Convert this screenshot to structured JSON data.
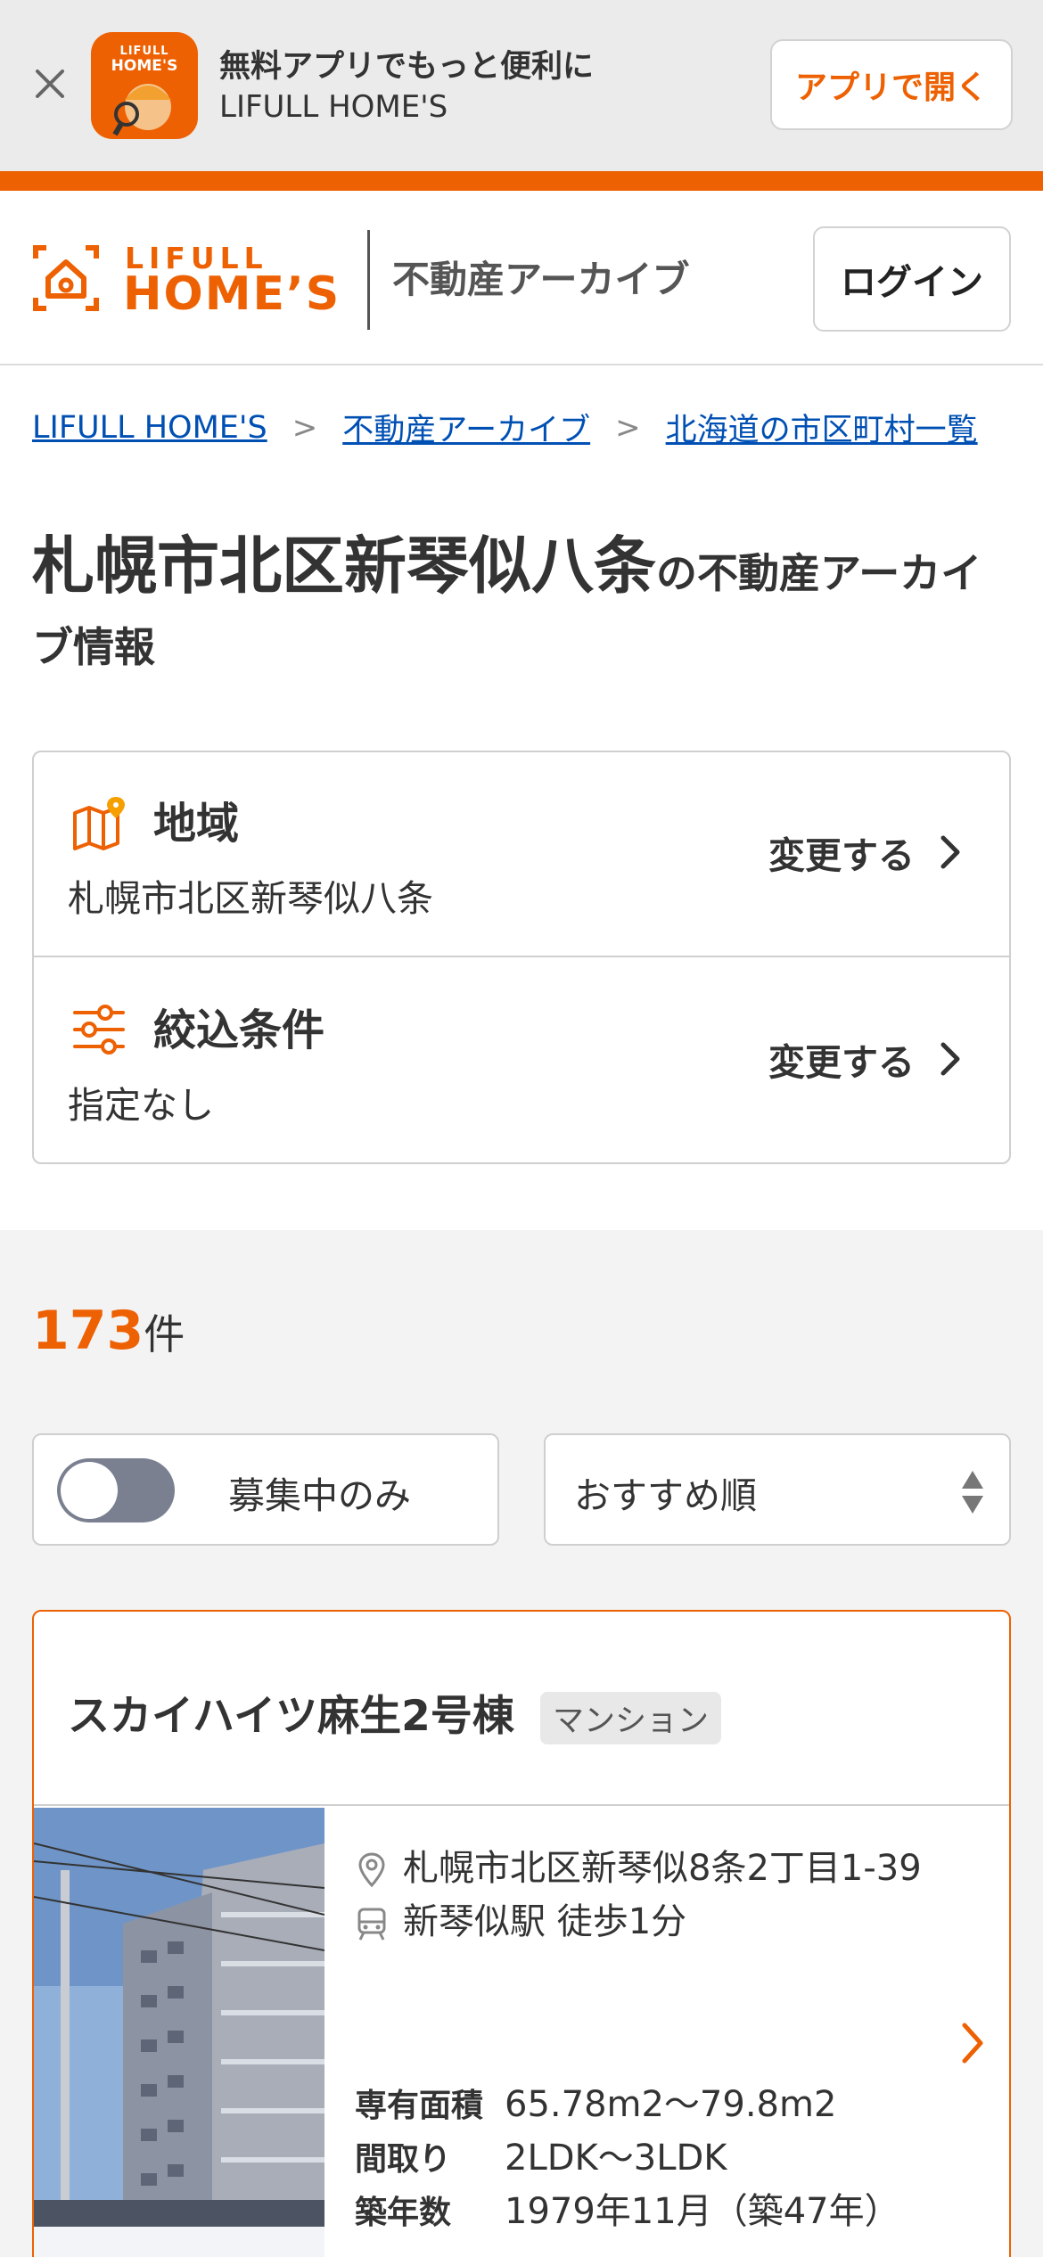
{
  "app_banner": {
    "title": "無料アプリでもっと便利に",
    "subtitle": "LIFULL HOME'S",
    "icon_small_text": "LIFULL",
    "icon_big_text": "HOME'S",
    "open_button": "アプリで開く"
  },
  "header": {
    "logo_line1": "LIFULL",
    "logo_line2": "HOME’S",
    "section": "不動産アーカイブ",
    "login_button": "ログイン"
  },
  "breadcrumb": [
    "LIFULL HOME'S",
    "不動産アーカイブ",
    "北海道の市区町村一覧"
  ],
  "breadcrumb_separator": ">",
  "page_title": {
    "main": "札幌市北区新琴似八条",
    "rest": "の不動産アーカイブ情報"
  },
  "filters": {
    "area": {
      "label": "地域",
      "value": "札幌市北区新琴似八条",
      "change": "変更する"
    },
    "conditions": {
      "label": "絞込条件",
      "value": "指定なし",
      "change": "変更する"
    }
  },
  "results": {
    "count": "173",
    "count_unit": "件",
    "toggle_label": "募集中のみ",
    "toggle_on": false,
    "sort_label": "おすすめ順"
  },
  "property": {
    "name": "スカイハイツ麻生2号棟",
    "type_tag": "マンション",
    "address": "札幌市北区新琴似8条2丁目1-39",
    "station": "新琴似駅 徒歩1分",
    "specs": [
      {
        "key": "専有面積",
        "value": "65.78m2〜79.8m2"
      },
      {
        "key": "間取り",
        "value": "2LDK〜3LDK"
      },
      {
        "key": "築年数",
        "value": "1979年11月（築47年）"
      }
    ]
  },
  "colors": {
    "brand": "#ed6103",
    "link": "#0050b4",
    "section_bg": "#f3f3f3"
  }
}
